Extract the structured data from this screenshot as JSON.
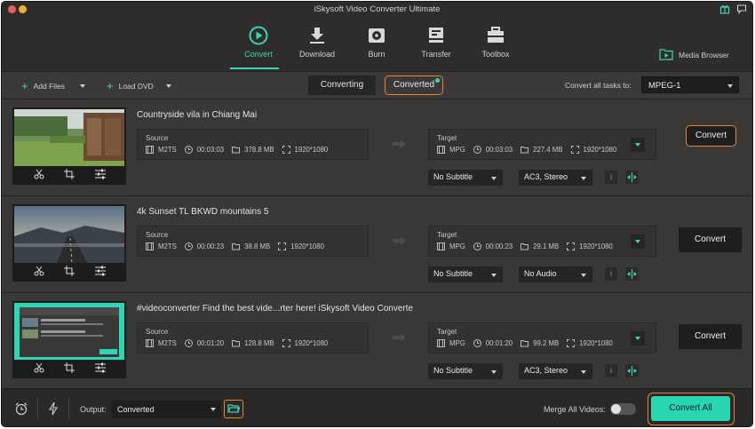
{
  "window": {
    "title": "iSkysoft Video Converter Ultimate"
  },
  "nav": {
    "items": [
      {
        "label": "Convert",
        "icon": "convert-icon",
        "active": true
      },
      {
        "label": "Download",
        "icon": "download-icon",
        "active": false
      },
      {
        "label": "Burn",
        "icon": "burn-icon",
        "active": false
      },
      {
        "label": "Transfer",
        "icon": "transfer-icon",
        "active": false
      },
      {
        "label": "Toolbox",
        "icon": "toolbox-icon",
        "active": false
      }
    ],
    "media_browser": "Media Browser"
  },
  "toolbar": {
    "add_files": "Add Files",
    "load_dvd": "Load DVD",
    "tab_converting": "Converting",
    "tab_converted": "Converted",
    "convert_all_label": "Convert all tasks to:",
    "format": "MPEG-1"
  },
  "tasks": [
    {
      "title": "Countryside vila in Chiang Mai",
      "source": {
        "label": "Source",
        "format": "M2TS",
        "duration": "00:03:03",
        "size": "378.8 MB",
        "resolution": "1920*1080"
      },
      "target": {
        "label": "Target",
        "format": "MPG",
        "duration": "00:03:03",
        "size": "227.4 MB",
        "resolution": "1920*1080"
      },
      "subtitle": "No Subtitle",
      "audio": "AC3, Stereo",
      "convert": "Convert"
    },
    {
      "title": "4k Sunset TL BKWD mountains 5",
      "source": {
        "label": "Source",
        "format": "M2TS",
        "duration": "00:00:23",
        "size": "38.8 MB",
        "resolution": "1920*1080"
      },
      "target": {
        "label": "Target",
        "format": "MPG",
        "duration": "00:00:23",
        "size": "29.1 MB",
        "resolution": "1920*1080"
      },
      "subtitle": "No Subtitle",
      "audio": "No Audio",
      "convert": "Convert"
    },
    {
      "title": "#videoconverter Find the best vide...rter here!  iSkysoft Video Converte",
      "source": {
        "label": "Source",
        "format": "M2TS",
        "duration": "00:01:20",
        "size": "128.8 MB",
        "resolution": "1920*1080"
      },
      "target": {
        "label": "Target",
        "format": "MPG",
        "duration": "00:01:20",
        "size": "99.2 MB",
        "resolution": "1920*1080"
      },
      "subtitle": "No Subtitle",
      "audio": "AC3, Stereo",
      "convert": "Convert"
    }
  ],
  "bottom": {
    "output_label": "Output:",
    "output_value": "Converted",
    "merge_label": "Merge All Videos:",
    "merge_on": false,
    "convert_all": "Convert All"
  },
  "colors": {
    "accent": "#3dd6b5",
    "highlight": "#e8833a",
    "button_green": "#28d7b1"
  }
}
